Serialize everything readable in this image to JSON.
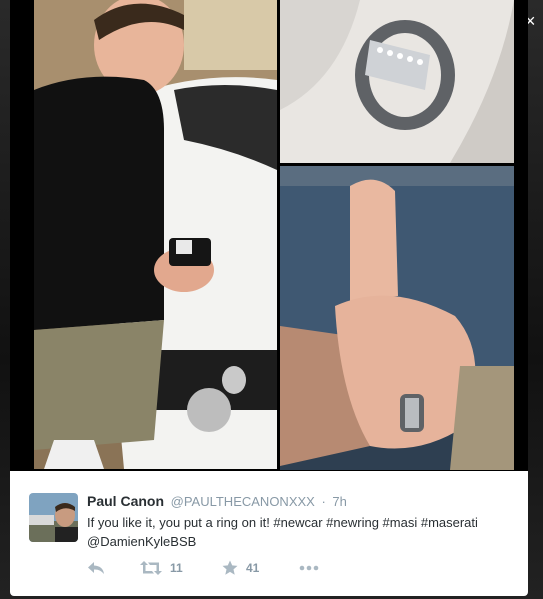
{
  "close_glyph": "×",
  "photos": {
    "count": 3,
    "items": [
      "man-with-ring-box-and-white-car",
      "ring-in-box-closeup",
      "thumbs-up-with-ring"
    ]
  },
  "tweet": {
    "display_name": "Paul Canon",
    "handle": "@PAULTHECANONXXX",
    "separator": "·",
    "timestamp": "7h",
    "text": "If you like it, you put a ring on it! #newcar #newring #masi #maserati @DamienKyleBSB",
    "retweet_count": "11",
    "like_count": "41"
  },
  "icons": {
    "reply": "reply-icon",
    "retweet": "retweet-icon",
    "like": "star-icon",
    "more": "more-icon"
  },
  "colors": {
    "name": "#292f33",
    "meta": "#8899a6",
    "action": "#aab8c2"
  }
}
